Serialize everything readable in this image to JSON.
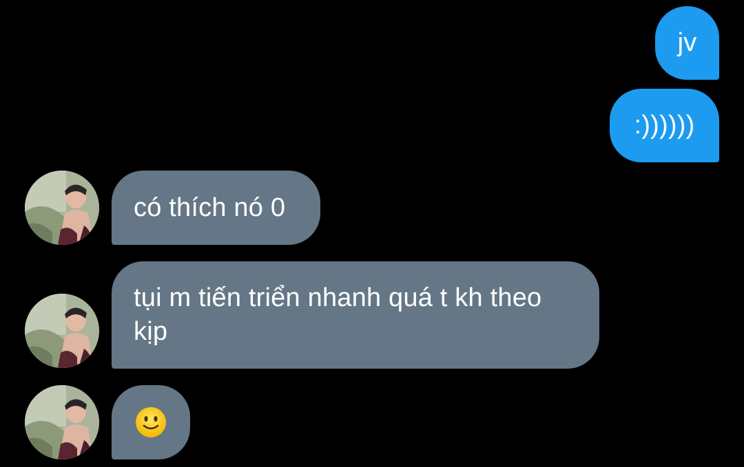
{
  "colors": {
    "background": "#000000",
    "outgoing_bubble": "#1d9bf0",
    "incoming_bubble": "#657786",
    "text": "#ffffff"
  },
  "messages": [
    {
      "direction": "outgoing",
      "text": "jv"
    },
    {
      "direction": "outgoing",
      "text": ":))))))"
    },
    {
      "direction": "incoming",
      "text": "có thích nó 0",
      "avatar": "user-avatar"
    },
    {
      "direction": "incoming",
      "text_line1": "tụi m tiến triển nhanh quá t kh theo",
      "text_line2": "kịp",
      "avatar": "user-avatar"
    },
    {
      "direction": "incoming",
      "icon": "slightly-smiling-face-emoji",
      "avatar": "user-avatar"
    }
  ]
}
